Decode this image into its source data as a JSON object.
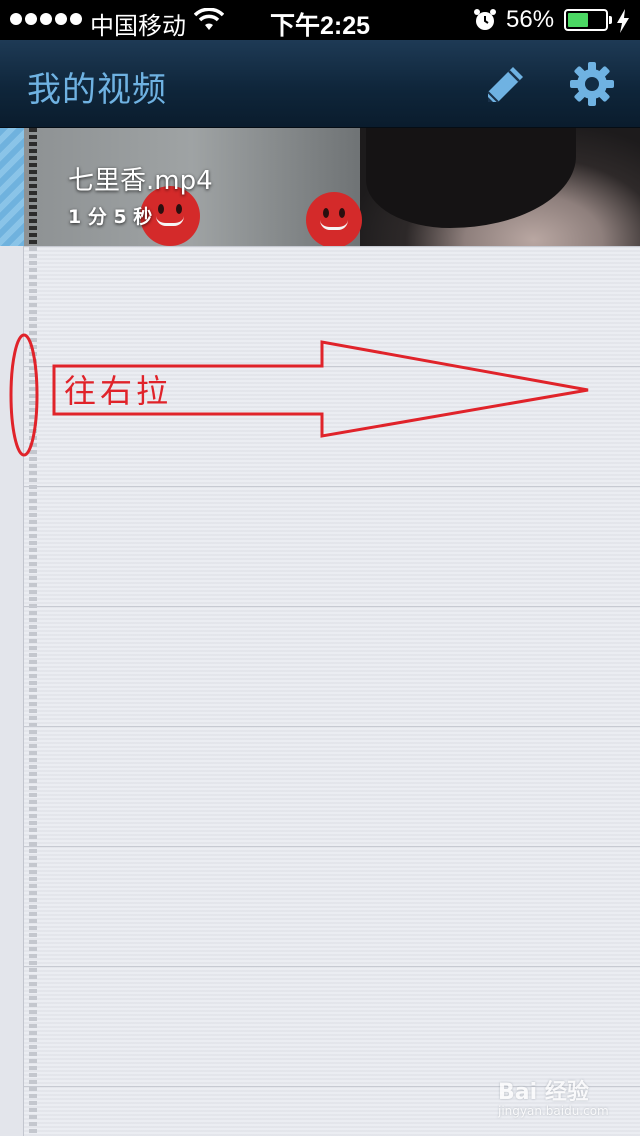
{
  "status_bar": {
    "carrier": "中国移动",
    "time": "下午2:25",
    "battery_percent": "56%",
    "battery_level": 0.56,
    "signal_bars": 5,
    "battery_color": "#4cd964"
  },
  "nav_bar": {
    "title": "我的视频",
    "title_color": "#6fb2e2",
    "edit_icon": "pencil-icon",
    "settings_icon": "gear-icon"
  },
  "videos": [
    {
      "title": "七里香.mp4",
      "duration": "1 分 5 秒"
    }
  ],
  "annotation": {
    "text": "往右拉",
    "color": "#e0232a"
  },
  "watermark": {
    "logo": "Bai 经验",
    "sub": "jingyan.baidu.com"
  }
}
